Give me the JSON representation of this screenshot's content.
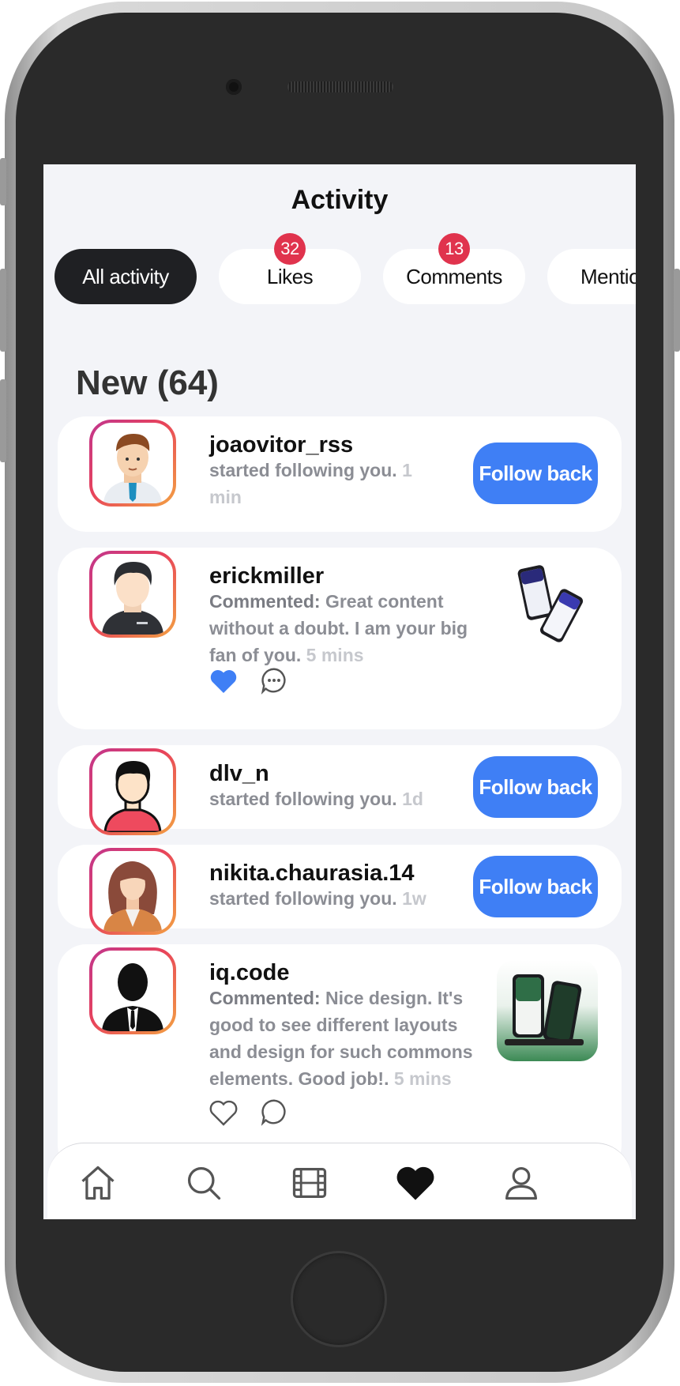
{
  "header": {
    "title": "Activity"
  },
  "filters": [
    {
      "label": "All activity",
      "active": true,
      "badge": null
    },
    {
      "label": "Likes",
      "active": false,
      "badge": "32"
    },
    {
      "label": "Comments",
      "active": false,
      "badge": "13"
    },
    {
      "label": "Mentio",
      "active": false,
      "badge": null
    }
  ],
  "section": {
    "title": "New (64)"
  },
  "activities": [
    {
      "username": "joaovitor_rss",
      "text": "started following you.",
      "time": "1",
      "time2": "min",
      "action": "Follow back"
    },
    {
      "username": "erickmiller",
      "prefix": "Commented:",
      "line1": "Great content",
      "line2": "without a doubt. I am your big",
      "line3": "fan of you.",
      "time": "5 mins",
      "liked": true
    },
    {
      "username": "dlv_n",
      "text": "started following you.",
      "time": "1d",
      "action": "Follow back"
    },
    {
      "username": "nikita.chaurasia.14",
      "text": "started following you.",
      "time": "1w",
      "action": "Follow back"
    },
    {
      "username": "iq.code",
      "prefix": "Commented:",
      "line1": "Nice design. It's",
      "line2": "good to see different layouts",
      "line3": "and design for such commons",
      "line4": "elements. Good job!.",
      "time": "5 mins",
      "liked": false
    }
  ],
  "bottom_nav": [
    "home-icon",
    "search-icon",
    "reels-icon",
    "heart-icon",
    "profile-icon"
  ],
  "colors": {
    "accent": "#3f7ff5",
    "badge": "#e0334d",
    "chip_active": "#1f2023",
    "background": "#f3f4f8"
  }
}
